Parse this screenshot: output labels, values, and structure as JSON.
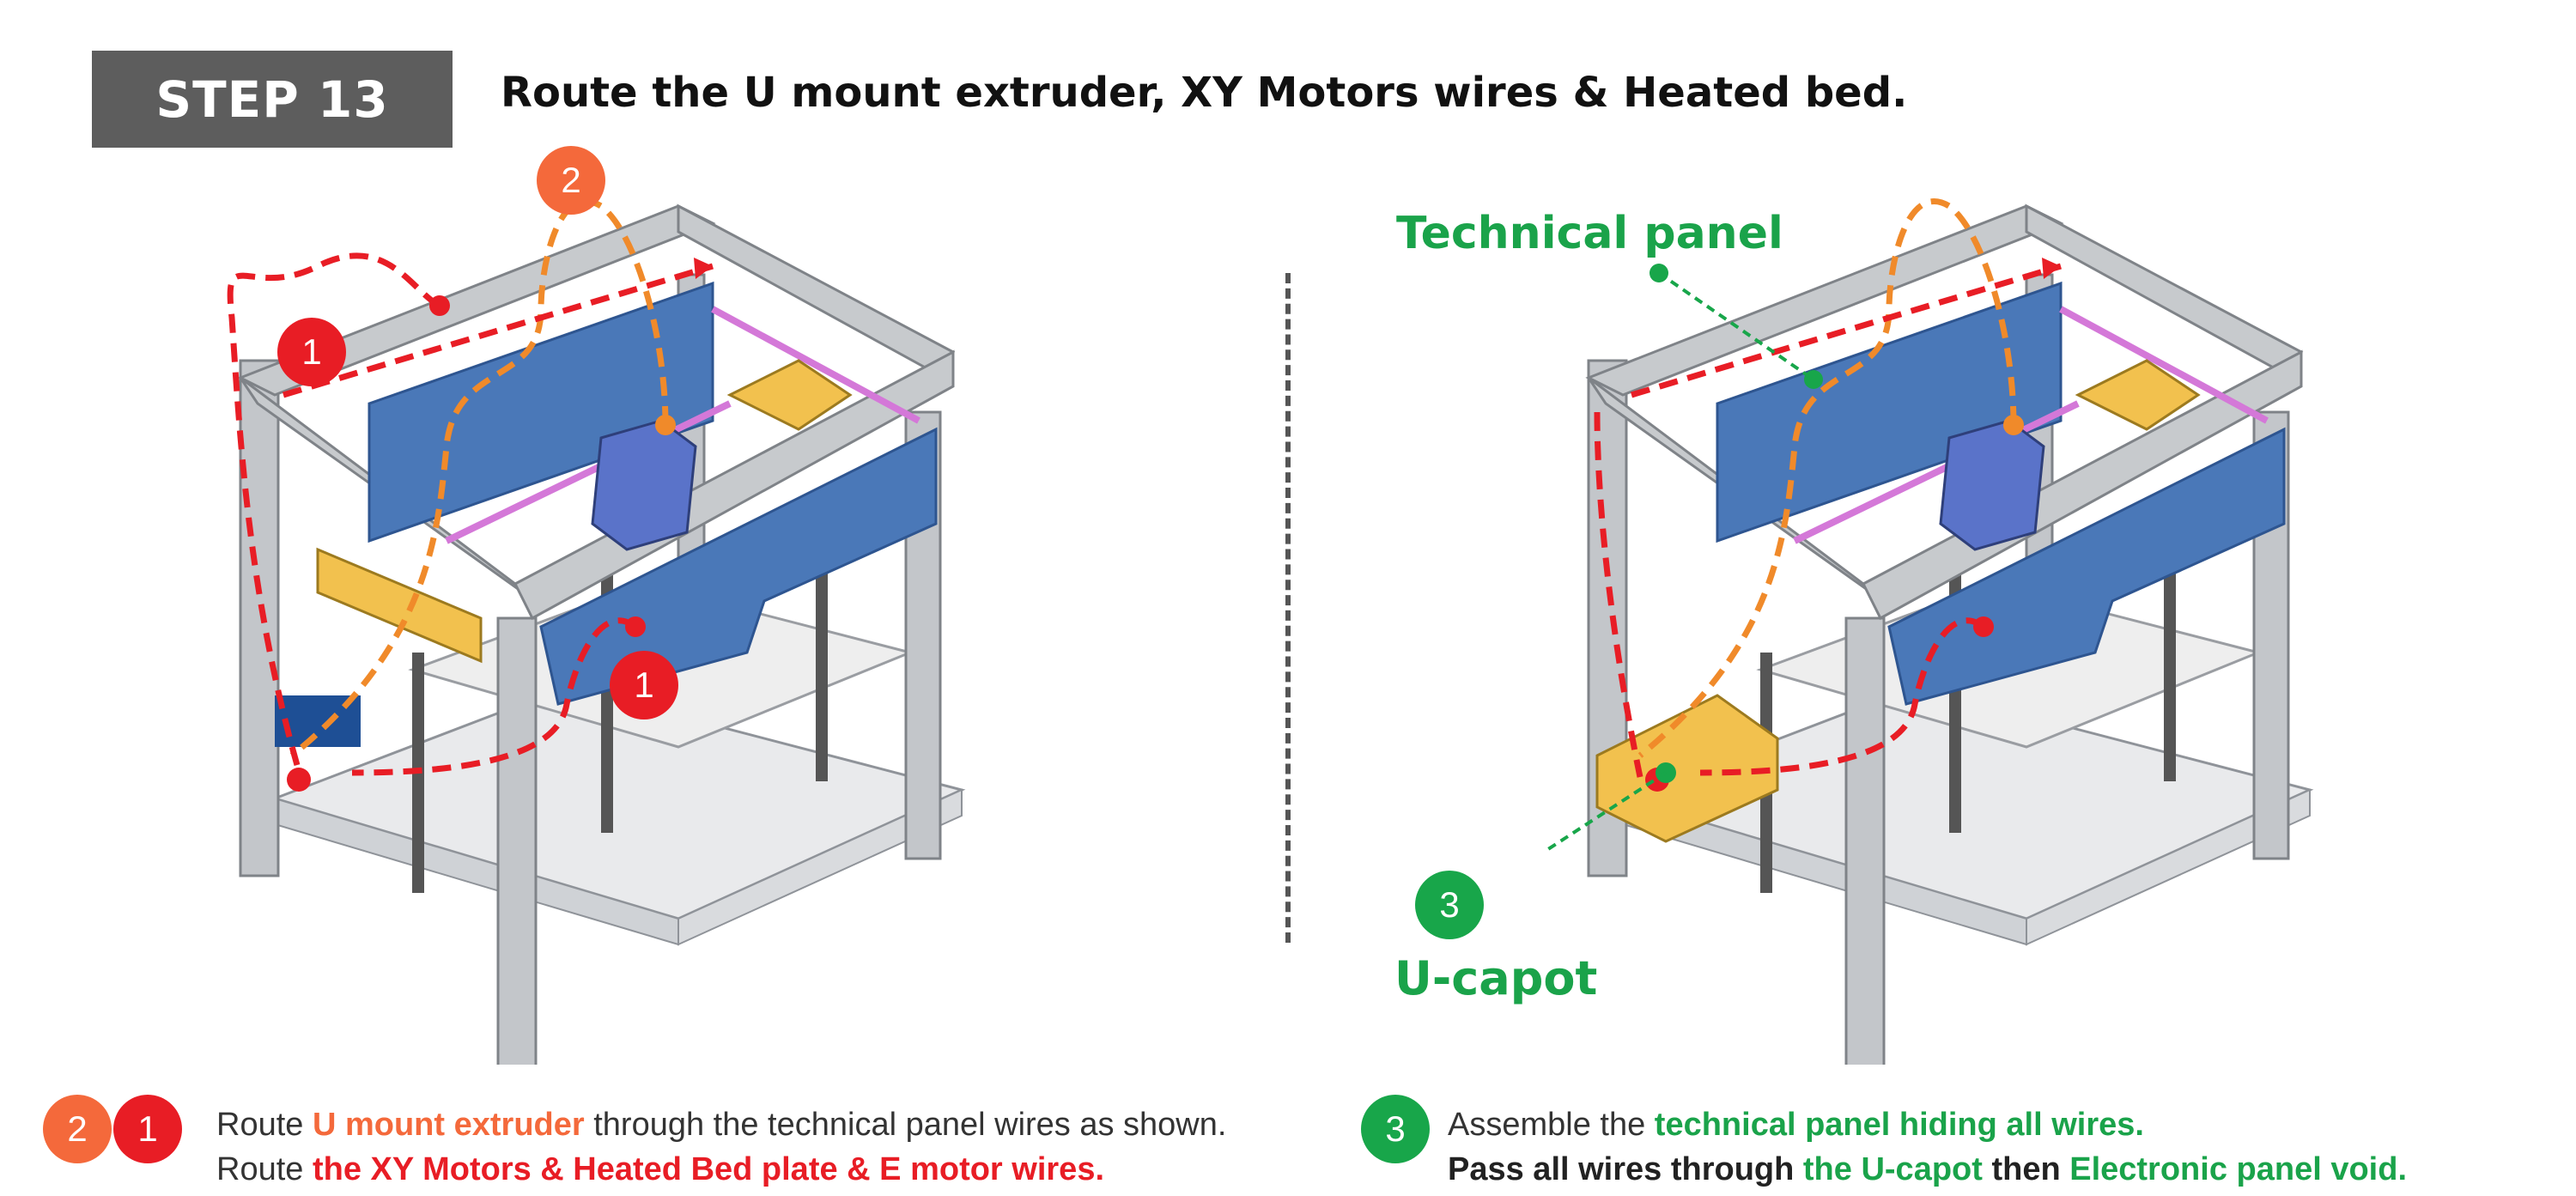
{
  "header": {
    "step_label": "STEP 13",
    "title": "Route the U mount extruder, XY Motors wires & Heated bed."
  },
  "left_figure": {
    "markers": [
      "2",
      "1",
      "1"
    ]
  },
  "right_figure": {
    "technical_panel_label": "Technical panel",
    "u_capot_label": "U-capot",
    "marker": "3"
  },
  "instructions_left": {
    "marker_orange": "2",
    "marker_red": "1",
    "line1_prefix": "Route ",
    "line1_highlight": "U mount extruder",
    "line1_suffix": " through the technical panel  wires as shown.",
    "line2_prefix": "Route ",
    "line2_highlight": "the XY Motors & Heated Bed plate & E motor wires."
  },
  "instructions_right": {
    "marker_green": "3",
    "line1_prefix": "Assemble the ",
    "line1_highlight": "technical panel hiding all wires.",
    "line2_prefix": "Pass all wires through ",
    "line2_highlight1": "the U-capot",
    "line2_mid": " then ",
    "line2_highlight2": "Electronic panel void."
  },
  "colors": {
    "orange": "#f4693b",
    "red": "#e81d25",
    "green": "#1aa34a",
    "panel_blue": "#4a78b8",
    "frame_gray": "#b8bcc2",
    "part_yellow": "#f2c14e"
  },
  "icons": [
    "printer-frame-illustration",
    "u-mount-extruder-icon",
    "wire-route-dashed-line"
  ]
}
